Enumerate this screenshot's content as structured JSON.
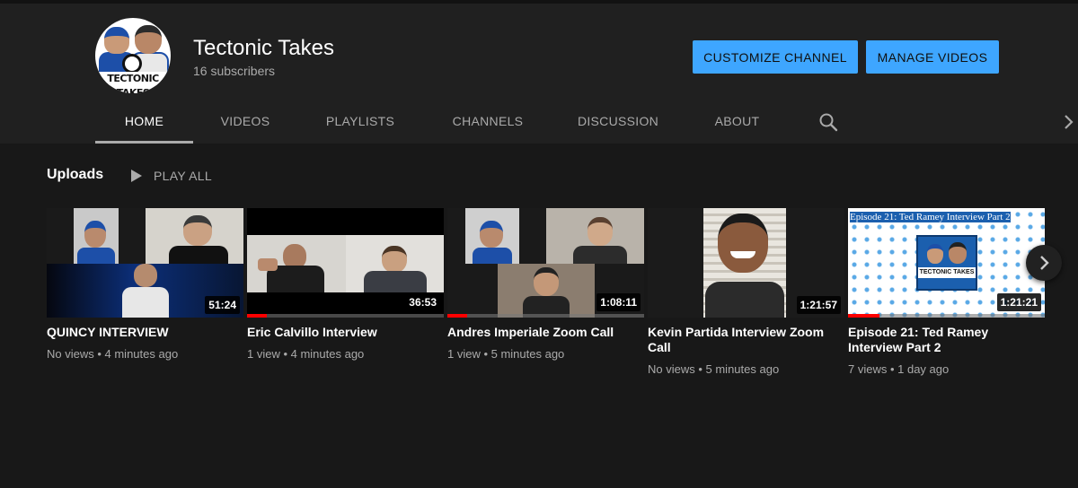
{
  "channel": {
    "name": "Tectonic Takes",
    "subscribers": "16 subscribers",
    "avatar_text": "TECTONIC TAKES"
  },
  "buttons": {
    "customize": "CUSTOMIZE CHANNEL",
    "manage": "MANAGE VIDEOS"
  },
  "tabs": [
    "HOME",
    "VIDEOS",
    "PLAYLISTS",
    "CHANNELS",
    "DISCUSSION",
    "ABOUT"
  ],
  "active_tab": "HOME",
  "icons": {
    "search": "search-icon",
    "tabs_scroll": "chevron-right-icon",
    "play_all": "play-icon",
    "shelf_next": "chevron-right-icon"
  },
  "uploads": {
    "title": "Uploads",
    "play_all": "PLAY ALL"
  },
  "videos": [
    {
      "title": "QUINCY INTERVIEW",
      "meta": "No views • 4 minutes ago",
      "duration": "51:24",
      "watched_fraction": 0
    },
    {
      "title": "Eric Calvillo Interview",
      "meta": "1 view • 4 minutes ago",
      "duration": "36:53",
      "watched_fraction": 0.1
    },
    {
      "title": "Andres Imperiale Zoom Call",
      "meta": "1 view • 5 minutes ago",
      "duration": "1:08:11",
      "watched_fraction": 0.1
    },
    {
      "title": "Kevin Partida Interview Zoom Call",
      "meta": "No views • 5 minutes ago",
      "duration": "1:21:57",
      "watched_fraction": 0
    },
    {
      "title": "Episode 21: Ted Ramey Interview Part 2",
      "meta": "7 views • 1 day ago",
      "duration": "1:21:21",
      "watched_fraction": 0.16,
      "thumb_text": "Episode 21: Ted Ramey Interview Part 2",
      "thumb_logo": "TECTONIC TAKES"
    }
  ],
  "colors": {
    "accent": "#3ea6ff",
    "progress": "#ff0000",
    "background": "#181818",
    "header": "#202020"
  }
}
